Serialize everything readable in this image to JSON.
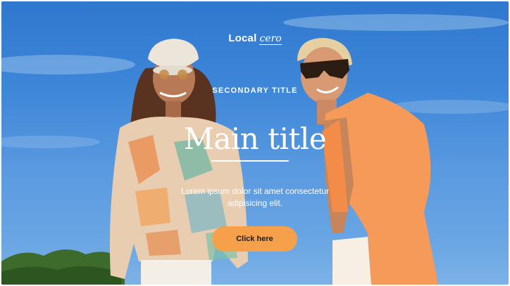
{
  "brand": {
    "name_part1": "Local",
    "name_part2": "cero"
  },
  "hero": {
    "secondary_title": "SECONDARY TITLE",
    "main_title": "Main title",
    "description": "Lorem ipsum dolor sit amet consectetur adipisicing elit.",
    "cta_label": "Click here"
  },
  "colors": {
    "accent": "#f7a04c",
    "sky": "#3d86d8",
    "text": "#ffffff"
  }
}
